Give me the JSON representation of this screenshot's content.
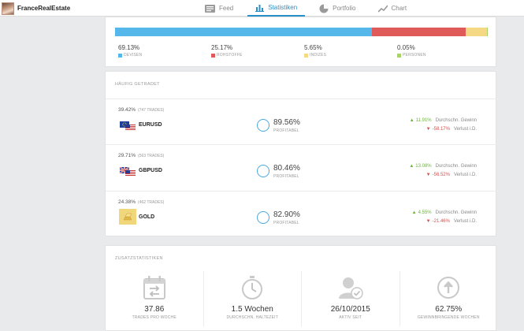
{
  "user": {
    "name": "FranceRealEstate"
  },
  "nav": [
    {
      "label": "Feed",
      "icon": "feed-icon"
    },
    {
      "label": "Statistiken",
      "icon": "bar-chart-icon",
      "active": true
    },
    {
      "label": "Portfolio",
      "icon": "pie-chart-icon"
    },
    {
      "label": "Chart",
      "icon": "line-chart-icon"
    }
  ],
  "allocation": {
    "items": [
      {
        "pct": "69.13%",
        "label": "DEVISEN",
        "color": "#56b8ea",
        "value": 69.13
      },
      {
        "pct": "25.17%",
        "label": "ROHSTOFFE",
        "color": "#e05a5a",
        "value": 25.17
      },
      {
        "pct": "5.65%",
        "label": "INDIZES",
        "color": "#f6d984",
        "value": 5.65
      },
      {
        "pct": "0.05%",
        "label": "PERSONEN",
        "color": "#a6d36a",
        "value": 0.05
      }
    ]
  },
  "traded": {
    "title": "HÄUFIG GETRADET",
    "rows": [
      {
        "share": "39.42%",
        "trades": "(747 TRADES)",
        "symbol": "EURUSD",
        "profit_pct": "89.56%",
        "profit_label": "PROFITABEL",
        "gain": "11.91%",
        "gain_label": "Durchschn. Gewinn",
        "loss": "-58.17%",
        "loss_label": "Verlust i.D."
      },
      {
        "share": "29.71%",
        "trades": "(563 TRADES)",
        "symbol": "GBPUSD",
        "profit_pct": "80.46%",
        "profit_label": "PROFITABEL",
        "gain": "13.08%",
        "gain_label": "Durchschn. Gewinn",
        "loss": "-56.52%",
        "loss_label": "Verlust i.D."
      },
      {
        "share": "24.38%",
        "trades": "(462 TRADES)",
        "symbol": "GOLD",
        "profit_pct": "82.90%",
        "profit_label": "PROFITABEL",
        "gain": "4.55%",
        "gain_label": "Durchschn. Gewinn",
        "loss": "-21.46%",
        "loss_label": "Verlust i.D."
      }
    ]
  },
  "extra": {
    "title": "ZUSATZSTATISTIKEN",
    "items": [
      {
        "value": "37.86",
        "label": "TRADES PRO WOCHE",
        "icon": "calendar-exchange-icon"
      },
      {
        "value": "1.5 Wochen",
        "label": "DURCHSCHN. HALTEZEIT",
        "icon": "stopwatch-icon"
      },
      {
        "value": "26/10/2015",
        "label": "AKTIV SEIT",
        "icon": "user-check-icon"
      },
      {
        "value": "62.75%",
        "label": "GEWINNBRINGENDE WOCHEN",
        "icon": "arrow-up-circle-icon"
      }
    ]
  }
}
